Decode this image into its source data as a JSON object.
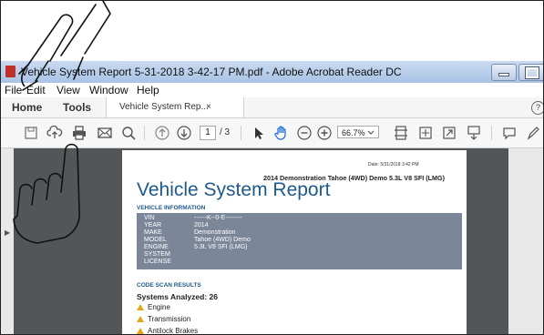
{
  "window": {
    "title": "Vehicle System Report 5-31-2018 3-42-17 PM.pdf - Adobe Acrobat Reader DC"
  },
  "menu": [
    "File",
    "Edit",
    "View",
    "Window",
    "Help"
  ],
  "tabs": {
    "home": "Home",
    "tools": "Tools",
    "doc": "Vehicle System Rep...",
    "close": "×",
    "help": "?"
  },
  "toolbar": {
    "page_current": "1",
    "page_total": "/ 3",
    "zoom": "66.7%",
    "icons": [
      "save-icon",
      "upload-icon",
      "print-icon",
      "email-icon",
      "search-icon",
      "page-up-icon",
      "page-down-icon",
      "select-cursor-icon",
      "hand-tool-icon",
      "zoom-out-icon",
      "zoom-in-icon",
      "fit-page-icon",
      "scroll-mode-icon",
      "full-screen-icon",
      "read-mode-icon",
      "comment-icon",
      "pen-icon"
    ]
  },
  "document": {
    "date": "Date: 5/31/2018 3:42 PM",
    "subtitle": "2014 Demonstration Tahoe (4WD) Demo 5.3L V8 SFI (LMG)",
    "title": "Vehicle System Report",
    "vehicle_info_heading": "VEHICLE INFORMATION",
    "vehicle_info": [
      {
        "key": "VIN",
        "value": "------K--0-E--------"
      },
      {
        "key": "YEAR",
        "value": "2014"
      },
      {
        "key": "MAKE",
        "value": "Demonstration"
      },
      {
        "key": "MODEL",
        "value": "Tahoe (4WD) Demo"
      },
      {
        "key": "ENGINE",
        "value": "5.3L V8 SFI (LMG)"
      },
      {
        "key": "SYSTEM",
        "value": ""
      },
      {
        "key": "LICENSE",
        "value": ""
      }
    ],
    "code_scan_heading": "CODE SCAN RESULTS",
    "systems_analyzed": "Systems Analyzed: 26",
    "systems": [
      "Engine",
      "Transmission",
      "Antilock Brakes"
    ]
  },
  "colors": {
    "title_blue": "#1f5a8c",
    "info_box": "#7b8798",
    "warning": "#e8a41a",
    "workarea": "#525659"
  }
}
